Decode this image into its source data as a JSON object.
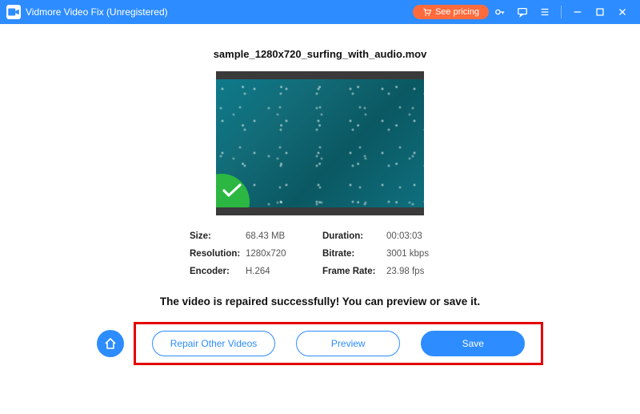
{
  "titlebar": {
    "title": "Vidmore Video Fix (Unregistered)",
    "see_pricing": "See pricing"
  },
  "file": {
    "name": "sample_1280x720_surfing_with_audio.mov"
  },
  "meta": {
    "size_label": "Size:",
    "size_value": "68.43 MB",
    "duration_label": "Duration:",
    "duration_value": "00:03:03",
    "resolution_label": "Resolution:",
    "resolution_value": "1280x720",
    "bitrate_label": "Bitrate:",
    "bitrate_value": "3001 kbps",
    "encoder_label": "Encoder:",
    "encoder_value": "H.264",
    "framerate_label": "Frame Rate:",
    "framerate_value": "23.98 fps"
  },
  "status": "The video is repaired successfully! You can preview or save it.",
  "buttons": {
    "repair_other": "Repair Other Videos",
    "preview": "Preview",
    "save": "Save"
  }
}
